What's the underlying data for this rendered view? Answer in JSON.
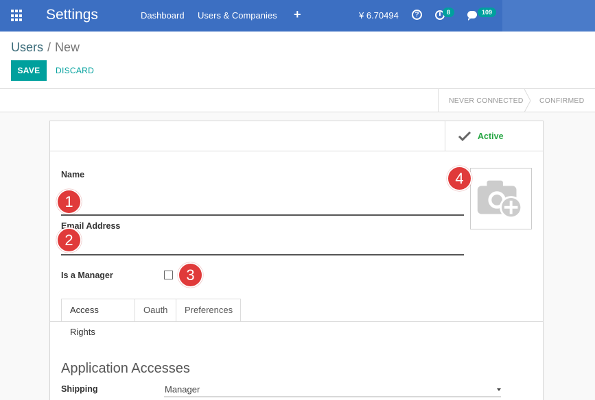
{
  "navbar": {
    "app_title": "Settings",
    "links": [
      "Dashboard",
      "Users & Companies"
    ],
    "plus_icon": "plus-icon",
    "currency_amount": "¥ 6.70494",
    "activity_count": "8",
    "messages_count": "109",
    "color": "#3c6fc2"
  },
  "breadcrumb": {
    "parent": "Users",
    "separator": "/",
    "current": "New"
  },
  "actions": {
    "save_label": "SAVE",
    "discard_label": "DISCARD"
  },
  "statusbar": {
    "stages": [
      "NEVER CONNECTED",
      "CONFIRMED"
    ]
  },
  "form": {
    "active_label": "Active",
    "name_label": "Name",
    "email_label": "Email Address",
    "manager_label": "Is a Manager",
    "markers": [
      "1",
      "2",
      "3",
      "4"
    ],
    "tabs": [
      "Access Rights",
      "Oauth",
      "Preferences"
    ],
    "section_title": "Application Accesses",
    "shipping_label": "Shipping",
    "shipping_value": "Manager"
  },
  "colors": {
    "accent": "#00a09d",
    "active_green": "#28a745",
    "marker_red": "#e03a3a"
  }
}
